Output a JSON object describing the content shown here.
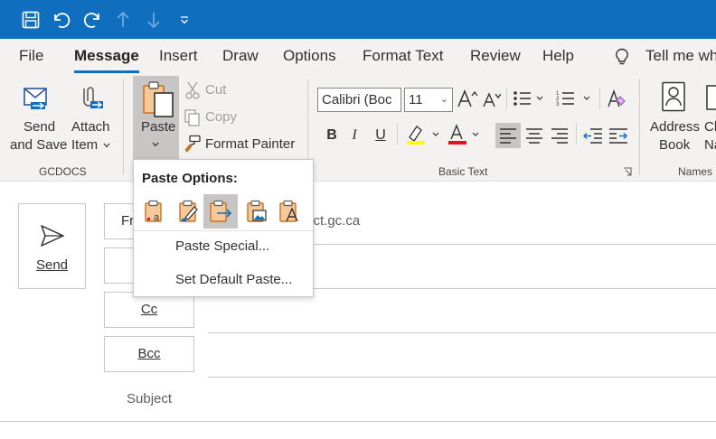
{
  "colors": {
    "titlebar": "#106ebe",
    "ribbon": "#f3f2f1",
    "accent": "#106ebe",
    "highlight_yellow": "#ffff00",
    "font_red": "#e81123"
  },
  "quick_access": {
    "icons": [
      "save-icon",
      "undo-icon",
      "redo-icon",
      "arrow-up-icon",
      "arrow-down-icon",
      "customize-icon"
    ]
  },
  "menu_tabs": [
    "File",
    "Message",
    "Insert",
    "Draw",
    "Options",
    "Format Text",
    "Review",
    "Help"
  ],
  "menu_active": "Message",
  "tell_me": "Tell me wh",
  "ribbon": {
    "gcdocs": {
      "send_save_1": "Send",
      "send_save_2": "and Save",
      "attach_1": "Attach",
      "attach_2": "Item",
      "label": "GCDOCS"
    },
    "clipboard": {
      "paste": "Paste",
      "cut": "Cut",
      "copy": "Copy",
      "format_painter": "Format Painter"
    },
    "basic_text": {
      "font_name": "Calibri (Boc",
      "font_size": "11",
      "bold": "B",
      "italic": "I",
      "underline": "U",
      "label": "Basic Text"
    },
    "names": {
      "address_1": "Address",
      "address_2": "Book",
      "check_1": "Ch",
      "check_2": "Na",
      "label": "Names"
    }
  },
  "compose": {
    "send": "Send",
    "from_partial": "Fr",
    "from_address": "sct.gc.ca",
    "cc": "Cc",
    "bcc": "Bcc",
    "subject": "Subject"
  },
  "paste_popup": {
    "title": "Paste Options:",
    "options": [
      "keep-source-formatting-icon",
      "merge-formatting-icon",
      "keep-text-only-selected-icon",
      "picture-icon",
      "keep-text-only-icon"
    ],
    "items": [
      "Paste Special...",
      "Set Default Paste..."
    ]
  }
}
